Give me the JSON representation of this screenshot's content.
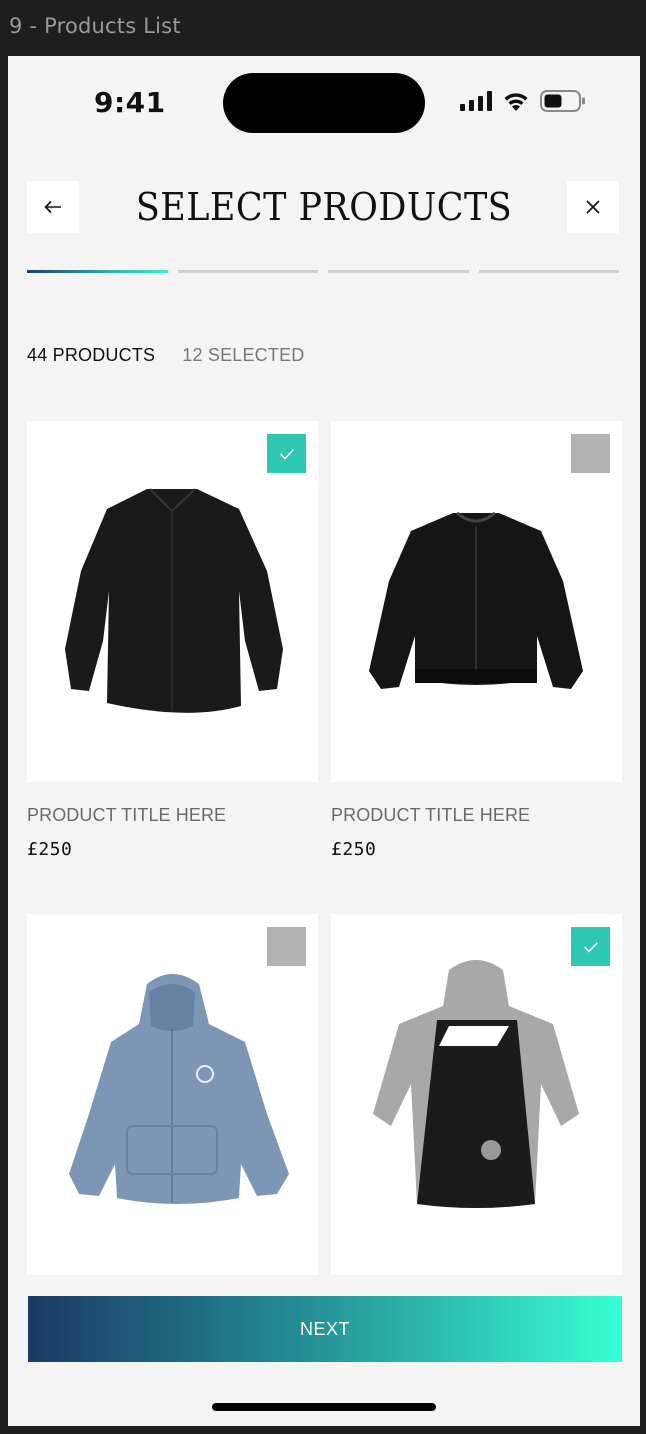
{
  "frame": {
    "label": "9 - Products List"
  },
  "status_bar": {
    "time": "9:41"
  },
  "header": {
    "title": "SELECT PRODUCTS",
    "back_icon": "arrow-left-icon",
    "close_icon": "close-icon"
  },
  "progress": {
    "total_steps": 4,
    "current_step": 1
  },
  "summary": {
    "products_count": "44 PRODUCTS",
    "selected_count": "12 SELECTED"
  },
  "products": [
    {
      "title": "PRODUCT TITLE HERE",
      "price": "£250",
      "selected": true,
      "image": "black-shirt"
    },
    {
      "title": "PRODUCT TITLE HERE",
      "price": "£250",
      "selected": false,
      "image": "black-leather-bomber-jacket"
    },
    {
      "title": "",
      "price": "",
      "selected": false,
      "image": "blue-zip-hoodie"
    },
    {
      "title": "",
      "price": "",
      "selected": true,
      "image": "grey-black-hooded-tee"
    }
  ],
  "footer": {
    "next_label": "NEXT"
  },
  "colors": {
    "accent": "#2ec7b1",
    "gradient_start": "#1b3a66",
    "gradient_end": "#37ffd6",
    "unchecked": "#b3b3b3"
  }
}
